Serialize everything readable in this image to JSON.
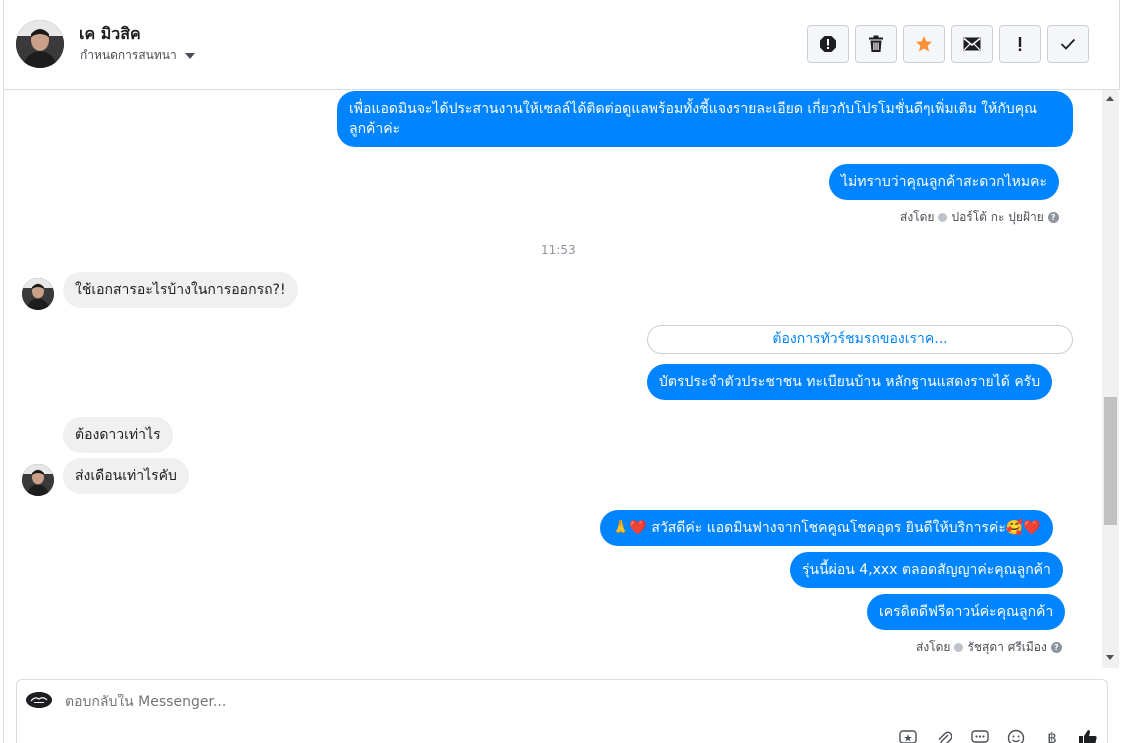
{
  "header": {
    "name": "เค มิวสิค",
    "subtitle": "กำหนดการสนทนา"
  },
  "toolbar": {
    "buttons": [
      {
        "icon": "report-spam-icon",
        "color": "#1c1e21"
      },
      {
        "icon": "trash-icon",
        "color": "#1c1e21"
      },
      {
        "icon": "star-icon",
        "color": "#f7923b"
      },
      {
        "icon": "envelope-icon",
        "color": "#1c1e21"
      },
      {
        "icon": "exclamation-icon",
        "color": "#1c1e21"
      },
      {
        "icon": "checkmark-icon",
        "color": "#1c1e21"
      }
    ]
  },
  "messages": {
    "out_1": "เพื่อแอดมินจะได้ประสานงานให้เซลล์ได้ติดต่อดูแลพร้อมทั้งชี้แจงรายละเอียด เกี่ยวกับโปรโมชั่นดีๆเพิ่มเติม ให้กับคุณลูกค้าค่ะ",
    "out_2": "ไม่ทราบว่าคุณลูกค้าสะดวกไหมคะ",
    "meta_1_prefix": "ส่งโดย",
    "meta_1_name": "ปอร์โต้ กะ ปุยฝ้าย",
    "time": "11:53",
    "in_1": "ใช้เอกสารอะไรบ้างในการออกรถ?!",
    "quick_reply": "ต้องการทัวร์ชมรถของเราค...",
    "out_3": "บัตรประจำตัวประชาชน ทะเบียนบ้าน หลักฐานแสดงรายได้ ครับ",
    "in_2": "ต้องดาวเท่าไร",
    "in_3": "ส่งเดือนเท่าไรคับ",
    "out_4": "🙏❤️ สวัสดีค่ะ แอดมินฟางจากโชคคูณโชคอุดร ยินดีให้บริการค่ะ🥰❤️",
    "out_5": "รุ่นนี้ผ่อน 4,xxx ตลอดสัญญาค่ะคุณลูกค้า",
    "out_6": "เครดิตดีฟรีดาวน์ค่ะคุณลูกค้า",
    "meta_2_prefix": "ส่งโดย",
    "meta_2_name": "รัชสุดา ศรีเมือง"
  },
  "composer": {
    "placeholder": "ตอบกลับใน Messenger..."
  },
  "colors": {
    "outgoing_bubble": "#0084ff",
    "incoming_bubble": "#f1f0f0",
    "accent_star": "#f7923b"
  }
}
